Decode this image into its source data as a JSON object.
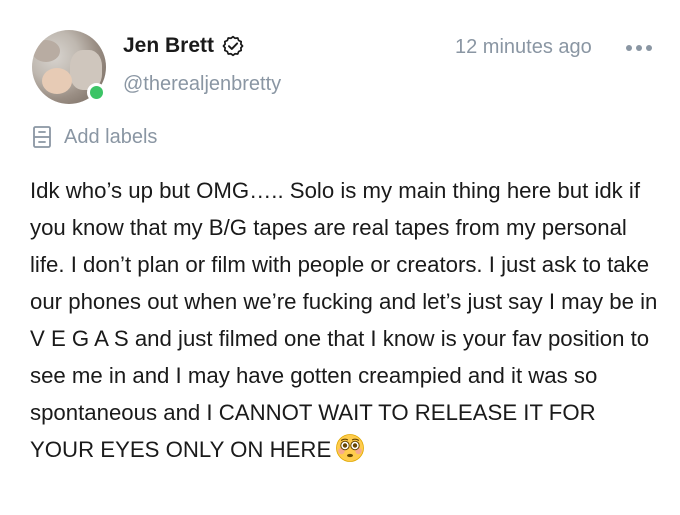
{
  "author": {
    "name": "Jen Brett",
    "handle": "@therealjenbretty",
    "online_color": "#3cc466",
    "verified_icon": "verified-badge-icon"
  },
  "meta": {
    "timestamp": "12 minutes ago",
    "more_icon": "more-dots-icon"
  },
  "labels": {
    "text": "Add labels",
    "icon": "label-icon"
  },
  "post": {
    "text": "Idk who’s up but OMG….. Solo is my main thing here but idk if you know that my B/G tapes are real tapes from my personal life. I don’t plan or film with people or creators. I just ask to take our phones out when we’re fucking and let’s just say I may be in V E G A S and just filmed one that I know is your fav position to see me in and I may have gotten creampied and it was so spontaneous and I CANNOT WAIT TO RELEASE IT FOR YOUR EYES ONLY ON HERE",
    "emoji": "flushed-face-emoji"
  },
  "colors": {
    "muted": "#8a96a3",
    "text": "#1a1a1a"
  }
}
